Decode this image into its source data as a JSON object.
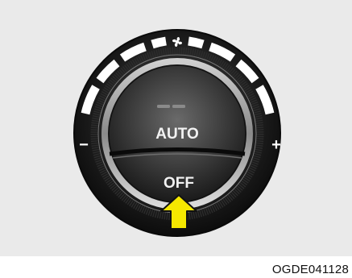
{
  "control": {
    "center_top_label": "AUTO",
    "center_bottom_label": "OFF",
    "minus_symbol": "−",
    "plus_symbol": "+",
    "fan_icon": "fan-icon",
    "arrow_icon": "up-arrow-icon",
    "arrow_color": "#f5e800"
  },
  "caption": "OGDE041128"
}
